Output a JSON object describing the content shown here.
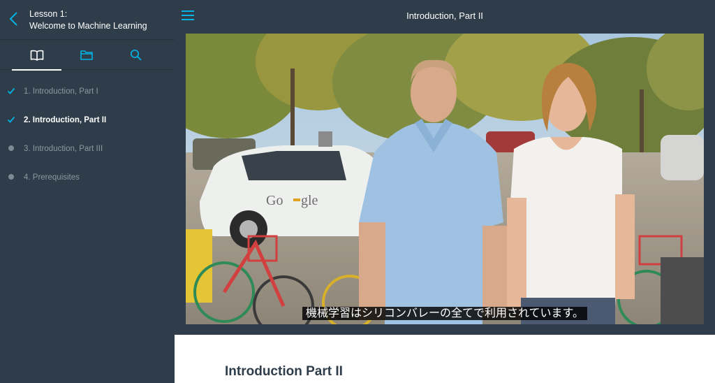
{
  "lesson": {
    "line1": "Lesson 1:",
    "line2": "Welcome to Machine Learning"
  },
  "sidebar_tabs": [
    {
      "icon": "book-icon",
      "active": true
    },
    {
      "icon": "folder-icon",
      "active": false
    },
    {
      "icon": "search-icon",
      "active": false
    }
  ],
  "concepts": [
    {
      "label": "1. Introduction, Part I",
      "status": "completed"
    },
    {
      "label": "2. Introduction, Part II",
      "status": "completed-current"
    },
    {
      "label": "3. Introduction, Part III",
      "status": "not-started"
    },
    {
      "label": "4. Prerequisites",
      "status": "not-started"
    }
  ],
  "header": {
    "title": "Introduction, Part II"
  },
  "video": {
    "subtitle": "機械学習はシリコンバレーの全てで利用されています。",
    "car_logo": "Google"
  },
  "content": {
    "heading": "Introduction Part II"
  },
  "colors": {
    "sidebar_bg": "#2e3d49",
    "accent": "#02b3e4",
    "text_muted": "#8b99a4"
  }
}
